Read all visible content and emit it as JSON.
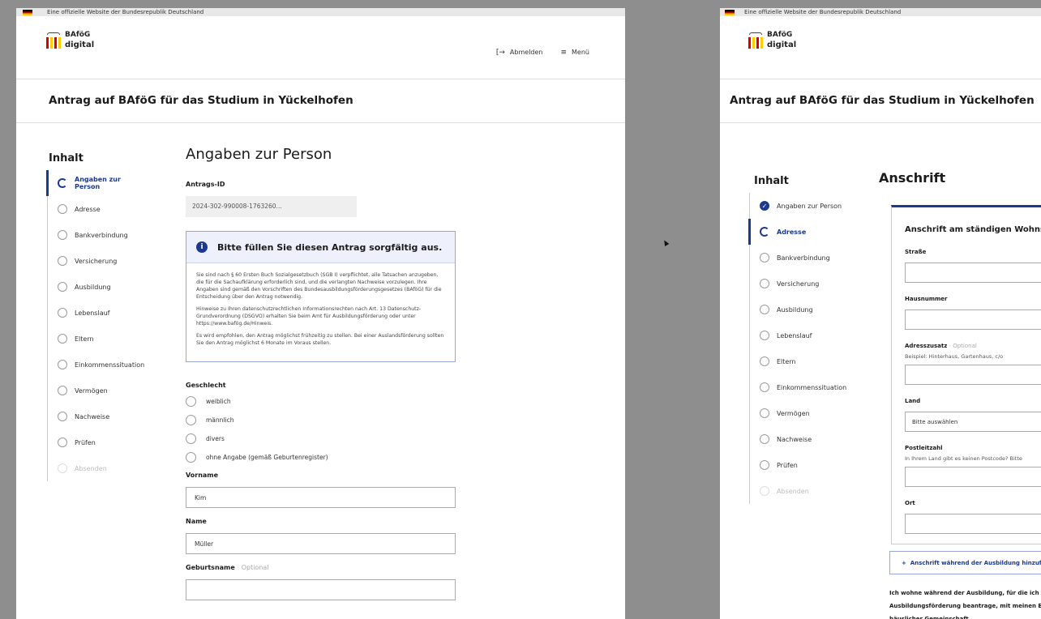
{
  "official_notice": "Eine offizielle Website der Bundesrepublik Deutschland",
  "logo": {
    "line1": "BAföG",
    "line2": "digital"
  },
  "header": {
    "logout": "Abmelden",
    "menu": "Menü"
  },
  "page_title": "Antrag auf BAföG für das Studium in Yückelhofen",
  "nav_title": "Inhalt",
  "nav_items": [
    "Angaben zur Person",
    "Adresse",
    "Bankverbindung",
    "Versicherung",
    "Ausbildung",
    "Lebenslauf",
    "Eltern",
    "Einkommenssituation",
    "Vermögen",
    "Nachweise",
    "Prüfen",
    "Absenden"
  ],
  "left": {
    "heading": "Angaben zur Person",
    "antrags_id_label": "Antrags-ID",
    "antrags_id_value": "2024-302-990008-1763260...",
    "alert_title": "Bitte füllen Sie diesen Antrag sorgfältig aus.",
    "alert_p1": "Sie sind nach § 60 Ersten Buch Sozialgesetzbuch (SGB I) verpflichtet, alle Tatsachen anzugeben, die für die Sachaufklärung erforderlich sind, und die verlangten Nachweise vorzulegen. Ihre Angaben sind gemäß den Vorschriften des Bundesausbildungsförderungsgesetzes (BAföG) für die Entscheidung über den Antrag notwendig.",
    "alert_p2": "Hinweise zu Ihren datenschutzrechtlichen Informationsrechten nach Art. 13 Datenschutz-Grundverordnung (DSGVO) erhalten Sie beim Amt für Ausbildungsförderung oder unter https://www.bafög.de/Hinweis.",
    "alert_p3": "Es wird empfohlen, den Antrag möglichst frühzeitig zu stellen. Bei einer Auslandsförderung sollten Sie den Antrag möglichst 6 Monate im Voraus stellen.",
    "gender_label": "Geschlecht",
    "gender_options": [
      "weiblich",
      "männlich",
      "divers",
      "ohne Angabe (gemäß Geburtenregister)"
    ],
    "vorname_label": "Vorname",
    "vorname_value": "Kim",
    "name_label": "Name",
    "name_value": "Müller",
    "geburtsname_label": "Geburtsname",
    "optional": "· Optional"
  },
  "right": {
    "heading": "Anschrift",
    "card_title": "Anschrift am ständigen Wohnsitz",
    "strasse": "Straße",
    "hausnummer": "Hausnummer",
    "adresszusatz": "Adresszusatz",
    "optional": "· Optional",
    "adresszusatz_hint": "Beispiel: Hinterhaus, Gartenhaus, c/o",
    "land": "Land",
    "land_value": "Bitte auswählen",
    "plz": "Postleitzahl",
    "plz_hint": "In Ihrem Land gibt es keinen Postcode? Bitte",
    "ort": "Ort",
    "add_button": "Anschrift während der Ausbildung hinzufügen",
    "text_line1": "Ich wohne während der Ausbildung, für die ich",
    "text_line2": "Ausbildungsförderung beantrage, mit meinen Eltern",
    "text_line3": "häuslicher Gemeinschaft"
  }
}
